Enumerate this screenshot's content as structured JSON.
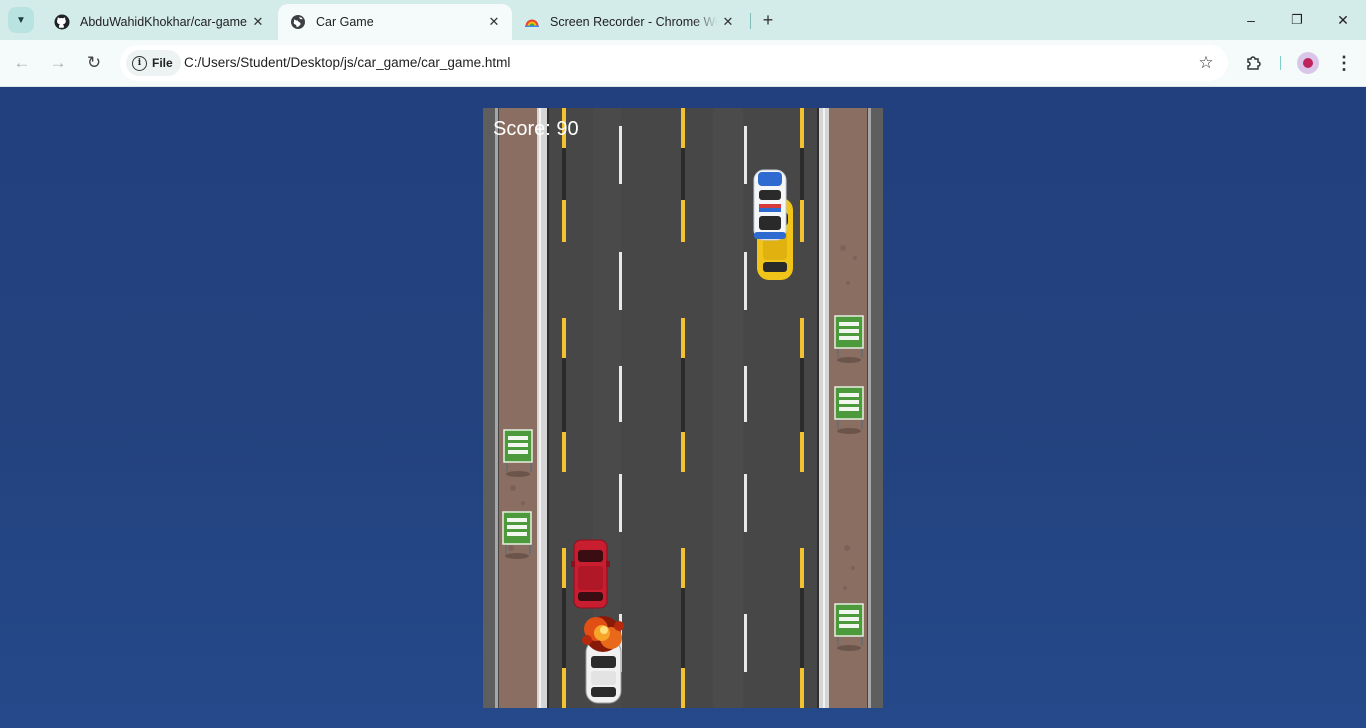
{
  "browser": {
    "tabs": [
      {
        "title": "AbduWahidKhokhar/car-game",
        "icon": "github-icon",
        "active": false
      },
      {
        "title": "Car Game",
        "icon": "globe-icon",
        "active": true
      },
      {
        "title": "Screen Recorder - Chrome Web Store",
        "icon": "chrome-web-store-icon",
        "active": false
      }
    ],
    "new_tab_label": "+",
    "window_controls": {
      "minimize": "–",
      "restore": "❐",
      "close": "✕"
    },
    "nav": {
      "back": "←",
      "forward": "→",
      "reload": "↻"
    },
    "address": {
      "scheme_chip": "File",
      "url": "C:/Users/Student/Desktop/js/car_game/car_game.html"
    },
    "toolbar_icons": [
      "bookmark-star-icon",
      "extensions-icon",
      "profile-avatar",
      "more-menu-icon"
    ]
  },
  "colors": {
    "tabbar": "#d3ecea",
    "toolbar": "#f4fbfa",
    "page_background": "#24427c",
    "road": "#464646",
    "yellow_line": "#f2c230",
    "white_line": "#e8e8e8",
    "sidewalk": "#8a6e62"
  },
  "game": {
    "score_label": "Score:",
    "score_value": "90",
    "score_text": "Score: 90",
    "player_car": "white-car-exploding",
    "traffic": [
      "police-car",
      "yellow-taxi",
      "red-car"
    ]
  }
}
